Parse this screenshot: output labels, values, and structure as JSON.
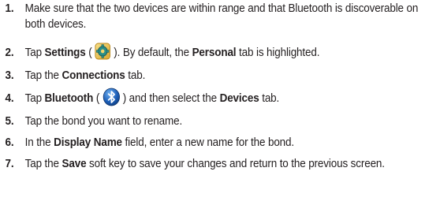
{
  "steps": [
    {
      "num": "1.",
      "parts": [
        {
          "t": "Make sure that the two devices are within range and that Bluetooth is discoverable on both devices."
        }
      ]
    },
    {
      "num": "2.",
      "parts": [
        {
          "t": "Tap "
        },
        {
          "b": "Settings"
        },
        {
          "t": " ( "
        },
        {
          "icon": "settings-icon"
        },
        {
          "t": " ). By default, the "
        },
        {
          "b": "Personal"
        },
        {
          "t": " tab is highlighted."
        }
      ]
    },
    {
      "num": "3.",
      "parts": [
        {
          "t": "Tap the "
        },
        {
          "b": "Connections"
        },
        {
          "t": " tab."
        }
      ]
    },
    {
      "num": "4.",
      "parts": [
        {
          "t": "Tap "
        },
        {
          "b": "Bluetooth"
        },
        {
          "t": " ( "
        },
        {
          "icon": "bluetooth-icon"
        },
        {
          "t": " ) and then select the "
        },
        {
          "b": "Devices"
        },
        {
          "t": " tab."
        }
      ]
    },
    {
      "num": "5.",
      "parts": [
        {
          "t": "Tap the bond you want to rename."
        }
      ]
    },
    {
      "num": "6.",
      "parts": [
        {
          "t": "In the "
        },
        {
          "b": "Display Name"
        },
        {
          "t": " field, enter a new name for the bond."
        }
      ]
    },
    {
      "num": "7.",
      "parts": [
        {
          "t": "Tap the "
        },
        {
          "b": "Save"
        },
        {
          "t": " soft key to save your changes and return to the previous screen."
        }
      ]
    }
  ],
  "colors": {
    "text": "#231f20",
    "bluetooth_blue": "#1d5fb8",
    "settings_teal": "#2a8f8a"
  }
}
